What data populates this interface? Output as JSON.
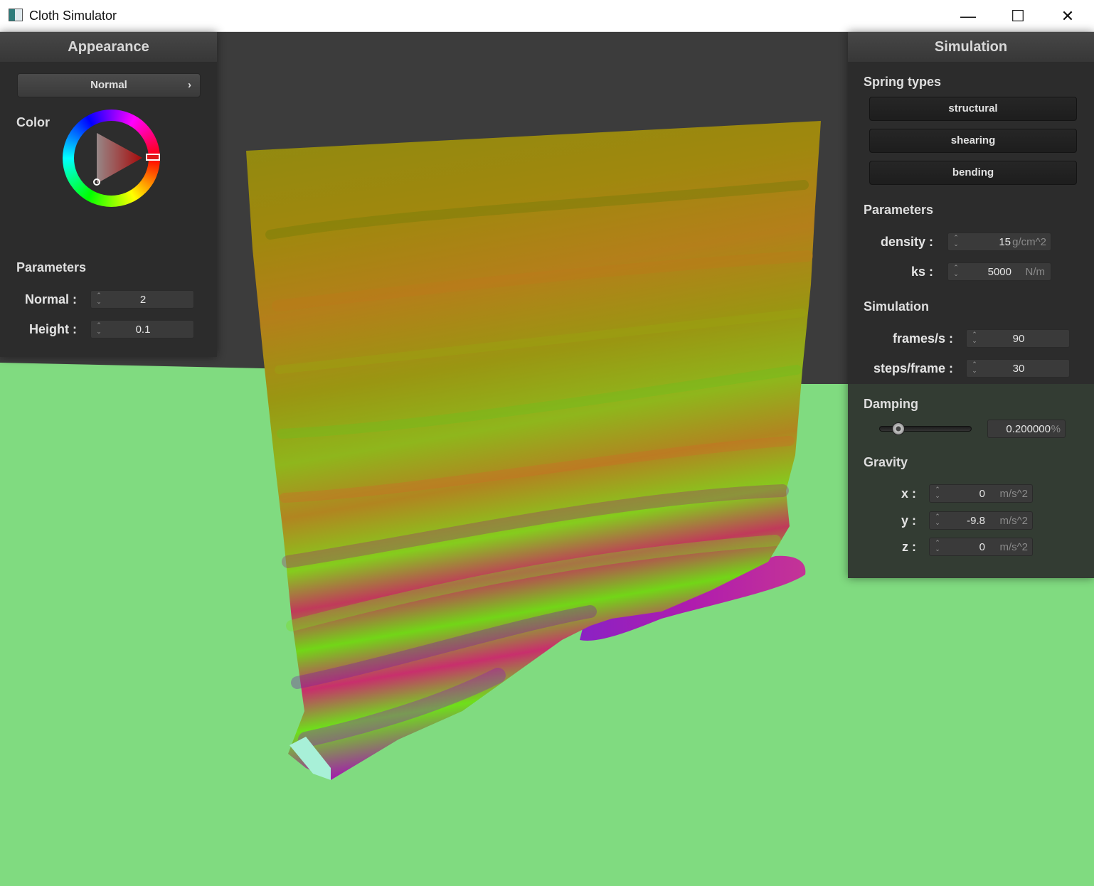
{
  "window": {
    "title": "Cloth Simulator",
    "buttons": [
      "—",
      "☐",
      "✕"
    ]
  },
  "scene": {
    "background_color": "#3c3c3c",
    "floor_color": "#80db80"
  },
  "appearance": {
    "header": "Appearance",
    "shader_select": "Normal",
    "shader_chevron": "›",
    "color_label": "Color",
    "parameters_label": "Parameters",
    "normal_label": "Normal :",
    "normal_value": "2",
    "height_label": "Height :",
    "height_value": "0.1"
  },
  "simulation": {
    "header": "Simulation",
    "spring_types_label": "Spring types",
    "spring_buttons": [
      "structural",
      "shearing",
      "bending"
    ],
    "parameters_label": "Parameters",
    "density_label": "density :",
    "density_value": "15",
    "density_unit": "g/cm^2",
    "ks_label": "ks :",
    "ks_value": "5000",
    "ks_unit": "N/m",
    "simulation_label": "Simulation",
    "fps_label": "frames/s :",
    "fps_value": "90",
    "steps_label": "steps/frame :",
    "steps_value": "30",
    "damping_label": "Damping",
    "damping_value": "0.200000",
    "damping_unit": "%",
    "damping_slider_fraction": 0.2,
    "gravity_label": "Gravity",
    "gx_label": "x :",
    "gx_value": "0",
    "gy_label": "y :",
    "gy_value": "-9.8",
    "gz_label": "z :",
    "gz_value": "0",
    "gravity_unit": "m/s^2"
  }
}
